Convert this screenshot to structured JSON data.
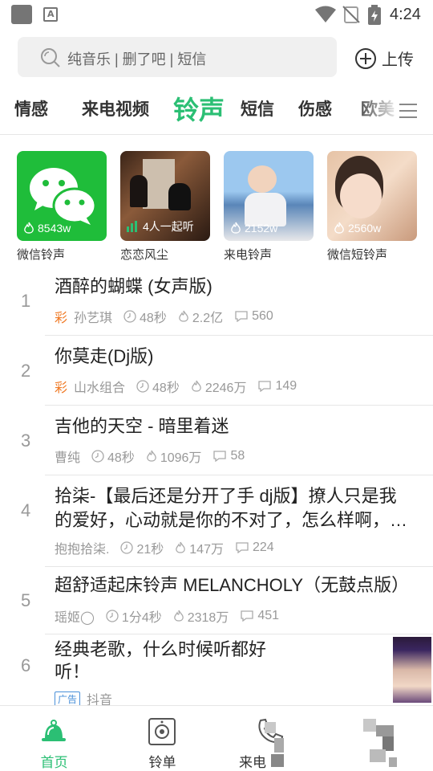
{
  "status_bar": {
    "time": "4:24"
  },
  "search": {
    "placeholder": "纯音乐 | 删了吧 | 短信",
    "upload_label": "上传"
  },
  "tabs": [
    {
      "label": "情感",
      "active": false
    },
    {
      "label": "来电视频",
      "active": false
    },
    {
      "label": "铃声",
      "active": true
    },
    {
      "label": "短信",
      "active": false
    },
    {
      "label": "伤感",
      "active": false
    },
    {
      "label": "欧美",
      "active": false
    }
  ],
  "cards": [
    {
      "label": "微信铃声",
      "stat": "8543w",
      "stat_icon": "flame-icon"
    },
    {
      "label": "恋恋风尘",
      "stat": "4人一起听",
      "stat_icon": "equalizer-icon"
    },
    {
      "label": "来电铃声",
      "stat": "2152w",
      "stat_icon": "flame-icon"
    },
    {
      "label": "微信短铃声",
      "stat": "2560w",
      "stat_icon": "flame-icon"
    }
  ],
  "songs": [
    {
      "num": "1",
      "title": "酒醉的蝴蝶 (女声版)",
      "colored": true,
      "colored_mark": "彩",
      "artist": "孙艺琪",
      "duration": "48秒",
      "plays": "2.2亿",
      "comments": "560"
    },
    {
      "num": "2",
      "title": "你莫走(Dj版)",
      "colored": true,
      "colored_mark": "彩",
      "artist": "山水组合",
      "duration": "48秒",
      "plays": "2246万",
      "comments": "149"
    },
    {
      "num": "3",
      "title": "吉他的天空 - 暗里着迷",
      "colored": false,
      "artist": "曹纯",
      "duration": "48秒",
      "plays": "1096万",
      "comments": "58"
    },
    {
      "num": "4",
      "title_line1": "拾柒-【最后还是分开了手  dj版】撩人只是我",
      "title_line2": "的爱好，心动就是你的不对了，怎么样啊，…",
      "colored": false,
      "artist": "抱抱拾柒.",
      "duration": "21秒",
      "plays": "147万",
      "comments": "224"
    },
    {
      "num": "5",
      "title": "超舒适起床铃声 MELANCHOLY（无鼓点版）",
      "colored": false,
      "artist": "瑶姬◯",
      "duration": "1分4秒",
      "plays": "2318万",
      "comments": "451"
    },
    {
      "num": "6",
      "title_line1": "经典老歌，什么时候听都好",
      "title_line2": "听！",
      "ad_badge": "广告",
      "source": "抖音"
    }
  ],
  "bottom_nav": [
    {
      "label": "首页",
      "active": true,
      "icon": "bell-icon"
    },
    {
      "label": "铃单",
      "active": false,
      "icon": "speaker-icon"
    },
    {
      "label": "来电",
      "active": false,
      "icon": "phone-icon"
    },
    {
      "label": "",
      "active": false,
      "icon": "profile-icon"
    }
  ],
  "colors": {
    "accent": "#2bbf74",
    "colored_mark": "#f07b27",
    "ad_badge": "#4a90d9"
  }
}
